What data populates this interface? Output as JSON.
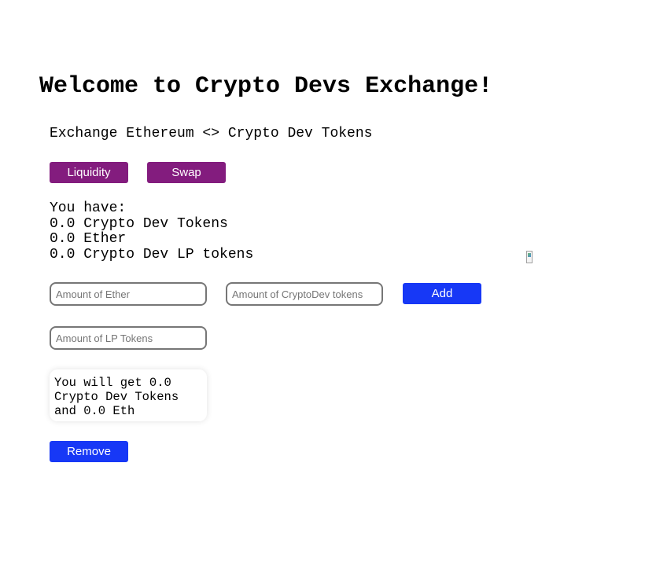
{
  "header": {
    "title": "Welcome to Crypto Devs Exchange!",
    "description": "Exchange Ethereum <> Crypto Dev Tokens"
  },
  "tabs": {
    "liquidity_label": "Liquidity",
    "swap_label": "Swap"
  },
  "balances": {
    "heading": "You have:",
    "crypto_dev_tokens": "0.0 Crypto Dev Tokens",
    "ether": "0.0 Ether",
    "lp_tokens": "0.0 Crypto Dev LP tokens"
  },
  "add_liquidity": {
    "ether_placeholder": "Amount of Ether",
    "cryptodev_placeholder": "Amount of CryptoDev tokens",
    "add_label": "Add"
  },
  "remove_liquidity": {
    "lp_placeholder": "Amount of LP Tokens",
    "result_text": "You will get 0.0 Crypto Dev Tokens and 0.0 Eth",
    "remove_label": "Remove"
  },
  "colors": {
    "tab_button": "#831c7e",
    "action_button": "#1738f6"
  },
  "icons": {
    "broken_image": "broken-image-icon"
  }
}
